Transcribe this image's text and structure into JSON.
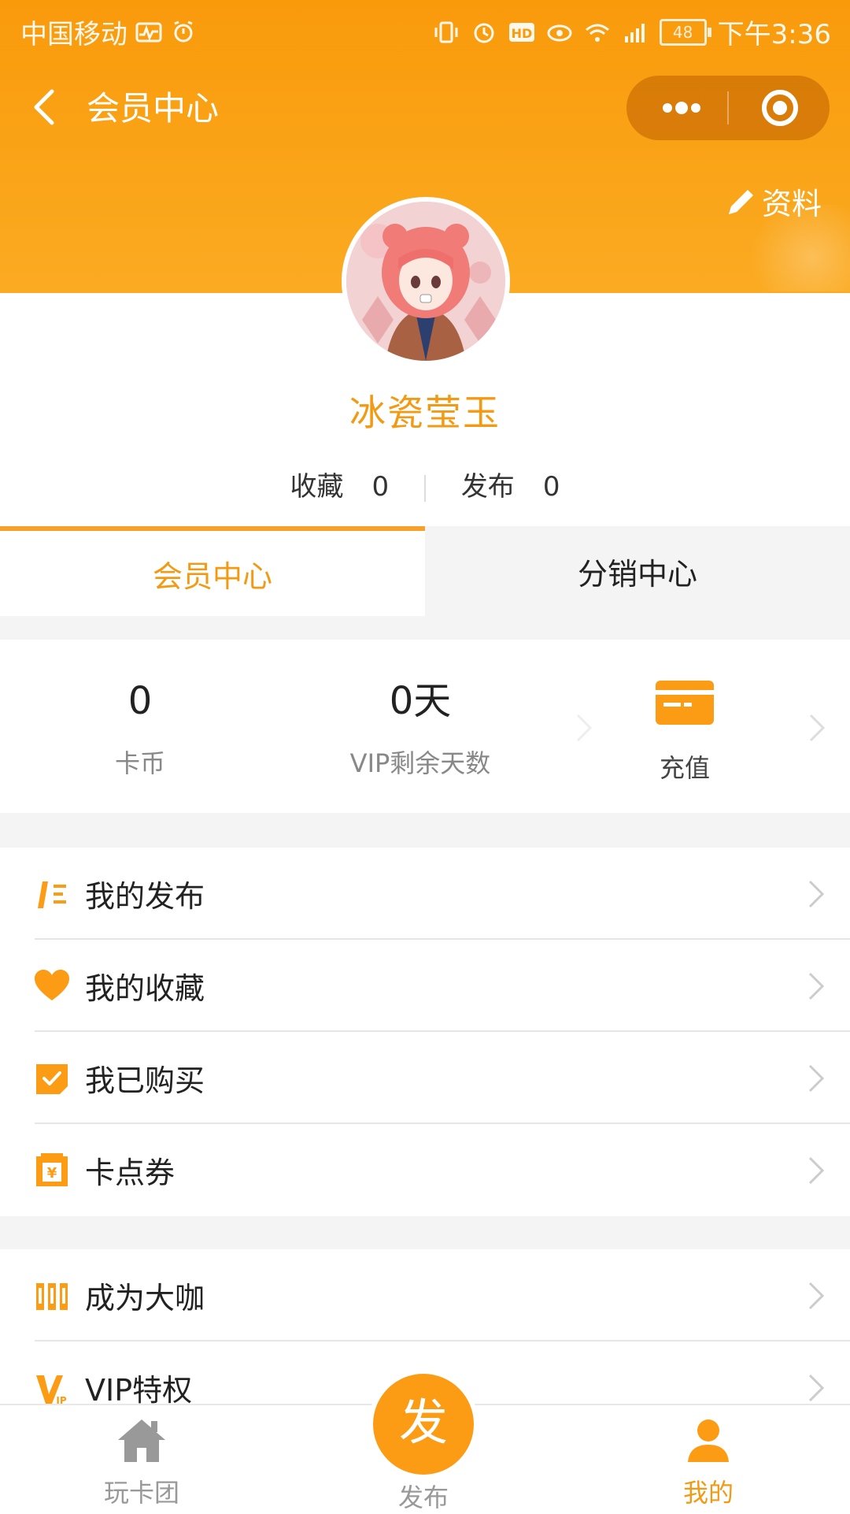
{
  "status_bar": {
    "carrier": "中国移动",
    "battery": "48",
    "time": "下午3:36"
  },
  "nav": {
    "title": "会员中心"
  },
  "profile": {
    "edit_label": "资料",
    "username": "冰瓷莹玉",
    "favorites_label": "收藏",
    "favorites_count": "0",
    "posts_label": "发布",
    "posts_count": "0"
  },
  "tabs": {
    "member": "会员中心",
    "distribution": "分销中心"
  },
  "wallet": {
    "coins_value": "0",
    "coins_label": "卡币",
    "vip_value": "0天",
    "vip_label": "VIP剩余天数",
    "recharge_label": "充值"
  },
  "menu_group1": [
    {
      "label": "我的发布",
      "icon": "post-icon"
    },
    {
      "label": "我的收藏",
      "icon": "heart-icon"
    },
    {
      "label": "我已购买",
      "icon": "purchased-icon"
    },
    {
      "label": "卡点券",
      "icon": "coupon-icon"
    }
  ],
  "menu_group2": [
    {
      "label": "成为大咖",
      "icon": "vip-expert-icon"
    },
    {
      "label": "VIP特权",
      "icon": "vip-icon"
    }
  ],
  "bottom_nav": {
    "home": "玩卡团",
    "publish_circle": "发",
    "publish": "发布",
    "mine": "我的"
  },
  "colors": {
    "accent": "#f39a14",
    "header": "#f99a0b"
  }
}
